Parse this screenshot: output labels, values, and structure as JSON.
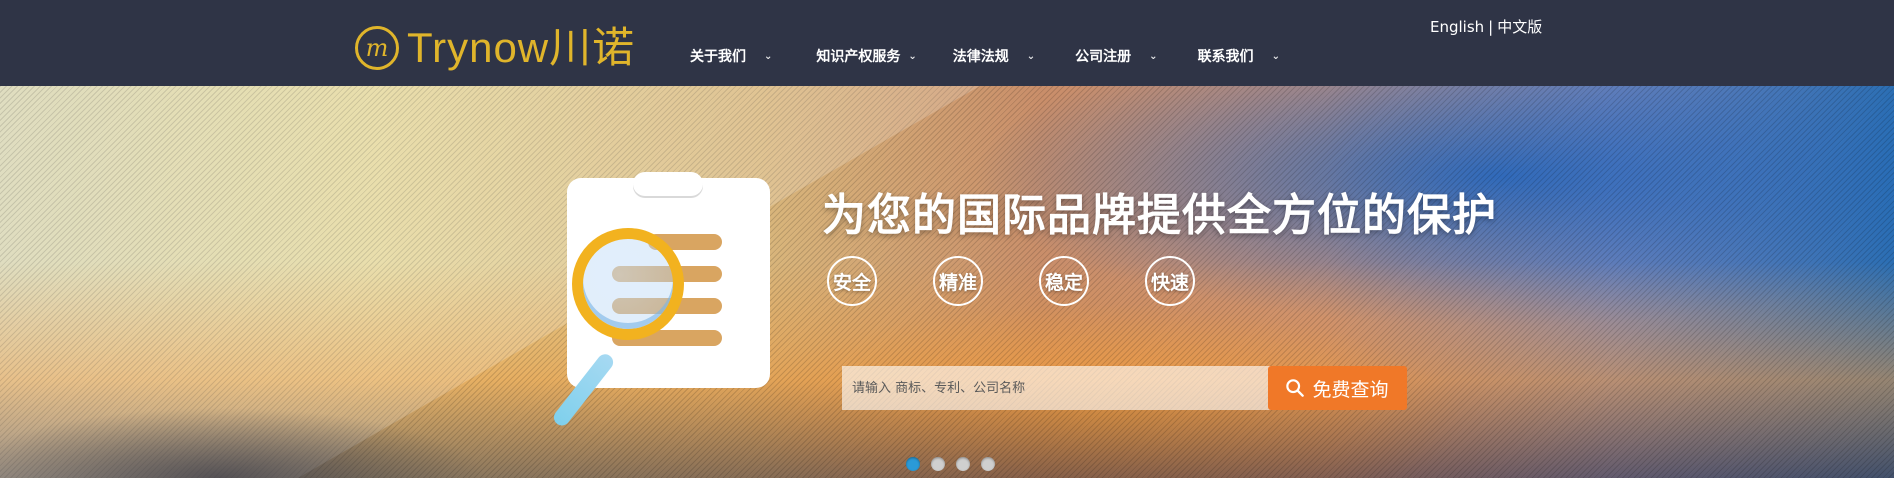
{
  "brand": {
    "mark": "m",
    "name": "Trynow川诺",
    "color": "#e0b52b"
  },
  "nav": {
    "items": [
      {
        "label": "关于我们",
        "icon": "chevron-down-icon"
      },
      {
        "label": "知识产权服务",
        "icon": "chevron-down-icon"
      },
      {
        "label": "法律法规",
        "icon": "chevron-down-icon"
      },
      {
        "label": "公司注册",
        "icon": "chevron-down-icon"
      },
      {
        "label": "联系我们",
        "icon": "chevron-down-icon"
      }
    ],
    "chevron": "⌄"
  },
  "language": {
    "english": "English",
    "separator": "|",
    "chinese": "中文版"
  },
  "banner": {
    "headline": "为您的国际品牌提供全方位的保护",
    "badges": [
      "安全",
      "精准",
      "稳定",
      "快速"
    ],
    "illustration": "clipboard-magnifier-icon",
    "slides": {
      "count": 4,
      "active_index": 0
    }
  },
  "search": {
    "placeholder": "请输入 商标、专利、公司名称",
    "value": "",
    "button_label": "免费查询",
    "button_color": "#f07828"
  }
}
